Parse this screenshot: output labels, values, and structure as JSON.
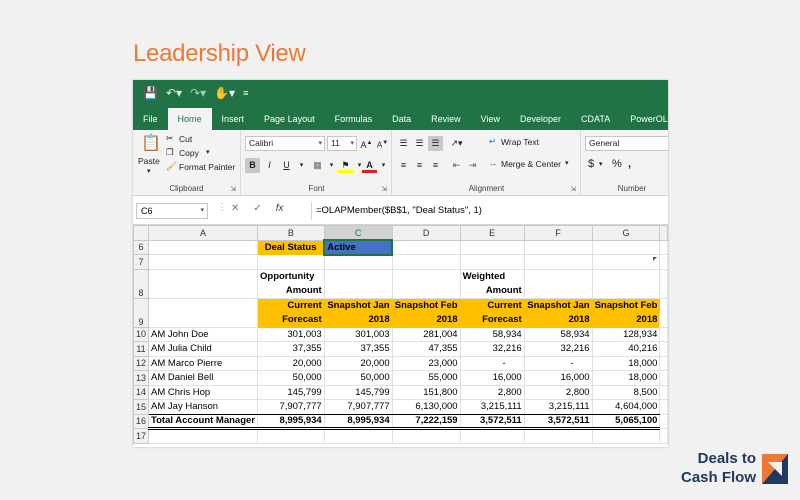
{
  "slide_title": "Leadership View",
  "ribbon_tabs": [
    "File",
    "Home",
    "Insert",
    "Page Layout",
    "Formulas",
    "Data",
    "Review",
    "View",
    "Developer",
    "CDATA",
    "PowerOLAP"
  ],
  "active_tab": "Home",
  "clipboard": {
    "paste": "Paste",
    "cut": "Cut",
    "copy": "Copy",
    "format_painter": "Format Painter",
    "group": "Clipboard"
  },
  "font": {
    "name": "Calibri",
    "size": "11",
    "group": "Font",
    "bold": "B",
    "italic": "I",
    "underline": "U"
  },
  "alignment": {
    "wrap_text": "Wrap Text",
    "merge_center": "Merge & Center",
    "group": "Alignment"
  },
  "number": {
    "format": "General",
    "currency": "$",
    "percent": "%",
    "group": "Number"
  },
  "formula_bar": {
    "name_box": "C6",
    "fx": "fx",
    "formula": "=OLAPMember($B$1, \"Deal Status\", 1)"
  },
  "columns": [
    "A",
    "B",
    "C",
    "D",
    "E",
    "F",
    "G"
  ],
  "selected_column": "C",
  "sheet": {
    "deal_status_label": "Deal Status",
    "deal_status_value": "Active",
    "header_top": {
      "B": "Opportunity",
      "E": "Weighted"
    },
    "header_mid": {
      "B": "Amount",
      "E": "Amount"
    },
    "header_row8": {
      "B": "Current",
      "C": "Snapshot Jan",
      "D": "Snapshot Feb",
      "E": "Current",
      "F": "Snapshot Jan",
      "G": "Snapshot Feb"
    },
    "header_row9": {
      "B": "Forecast",
      "C": "2018",
      "D": "2018",
      "E": "Forecast",
      "F": "2018",
      "G": "2018"
    },
    "rows": [
      {
        "row": "10",
        "label": "AM John Doe",
        "values": [
          "301,003",
          "301,003",
          "281,004",
          "58,934",
          "58,934",
          "128,934"
        ]
      },
      {
        "row": "11",
        "label": "AM Julia Child",
        "values": [
          "37,355",
          "37,355",
          "47,355",
          "32,216",
          "32,216",
          "40,216"
        ]
      },
      {
        "row": "12",
        "label": "AM Marco Pierre",
        "values": [
          "20,000",
          "20,000",
          "23,000",
          "-",
          "-",
          "18,000"
        ]
      },
      {
        "row": "13",
        "label": "AM Daniel Bell",
        "values": [
          "50,000",
          "50,000",
          "55,000",
          "16,000",
          "16,000",
          "18,000"
        ]
      },
      {
        "row": "14",
        "label": "AM Chris Hop",
        "values": [
          "145,799",
          "145,799",
          "151,800",
          "2,800",
          "2,800",
          "8,500"
        ]
      },
      {
        "row": "15",
        "label": "AM Jay Hanson",
        "values": [
          "7,907,777",
          "7,907,777",
          "6,130,000",
          "3,215,111",
          "3,215,111",
          "4,604,000"
        ]
      }
    ],
    "total": {
      "row": "16",
      "label": "Total Account Manager",
      "values": [
        "8,995,934",
        "8,995,934",
        "7,222,159",
        "3,572,511",
        "3,572,511",
        "5,065,100"
      ]
    }
  },
  "logo": {
    "line1": "Deals to",
    "line2": "Cash Flow",
    "accent_colors": [
      "#1f3864",
      "#ea7a36"
    ]
  },
  "colors": {
    "excel_green": "#217346",
    "header_orange": "#ffc000",
    "selection_blue": "#4472c4",
    "title_orange": "#ea7a36"
  }
}
